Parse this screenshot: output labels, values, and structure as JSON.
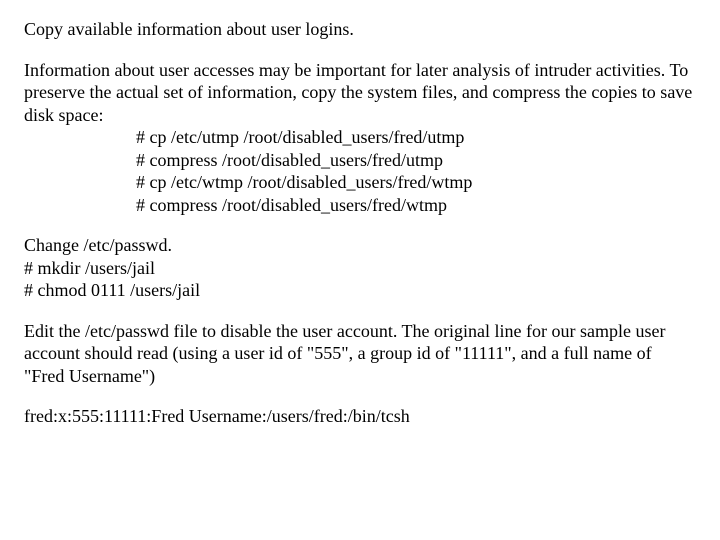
{
  "section1": {
    "heading": "Copy available information about user logins.",
    "intro": "Information about user accesses may be important for later analysis of intruder activities. To preserve the actual set of information, copy the system files, and compress the copies to save disk space:",
    "commands": [
      "# cp /etc/utmp /root/disabled_users/fred/utmp",
      "# compress /root/disabled_users/fred/utmp",
      "# cp /etc/wtmp /root/disabled_users/fred/wtmp",
      "# compress /root/disabled_users/fred/wtmp"
    ]
  },
  "section2": {
    "heading": "Change /etc/passwd.",
    "commands": [
      " # mkdir /users/jail",
      " # chmod 0111 /users/jail"
    ]
  },
  "section3": {
    "text": "Edit the /etc/passwd file to disable the user account. The original line for our sample user account should read (using a user id of \"555\", a group id of \"11111\", and a full name of \"Fred Username\")"
  },
  "section4": {
    "line": "fred:x:555:11111:Fred Username:/users/fred:/bin/tcsh"
  }
}
